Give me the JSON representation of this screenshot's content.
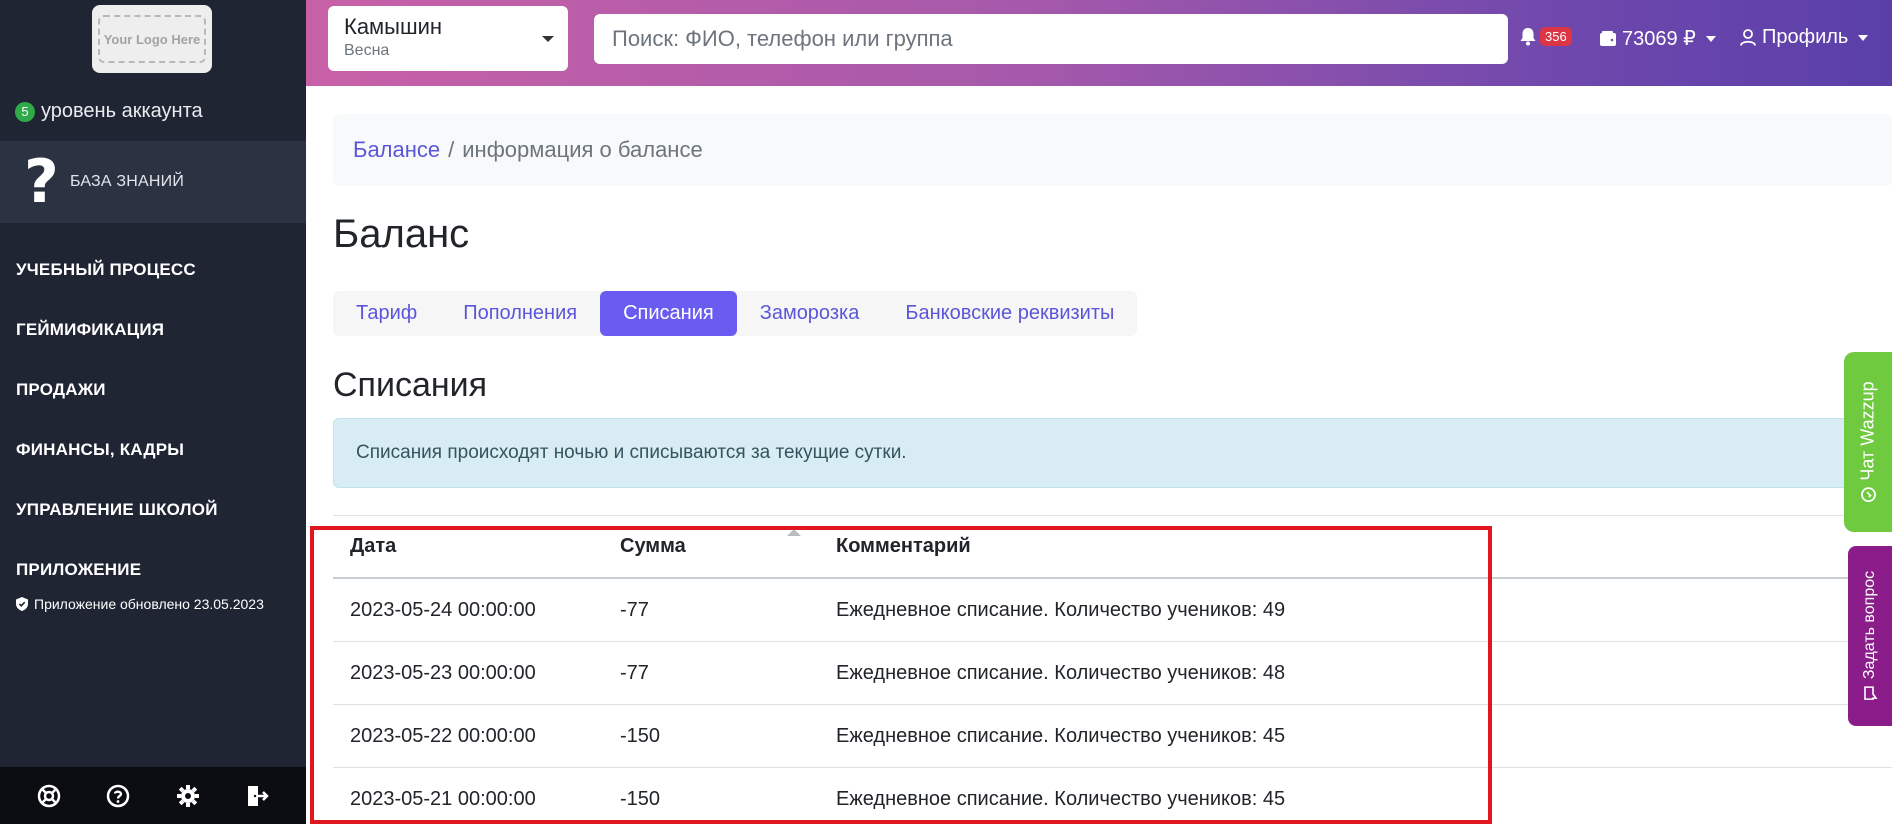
{
  "sidebar": {
    "logo_text": "Your Logo Here",
    "level_number": "5",
    "level_label": "уровень аккаунта",
    "knowledge_base_label": "БАЗА ЗНАНИЙ",
    "nav_items": [
      {
        "label": "УЧЕБНЫЙ ПРОЦЕСС"
      },
      {
        "label": "ГЕЙМИФИКАЦИЯ"
      },
      {
        "label": "ПРОДАЖИ"
      },
      {
        "label": "ФИНАНСЫ, КАДРЫ"
      },
      {
        "label": "УПРАВЛЕНИЕ ШКОЛОЙ"
      },
      {
        "label": "ПРИЛОЖЕНИЕ"
      }
    ],
    "update_note": "Приложение обновлено 23.05.2023",
    "bottom_icons": [
      "support-icon",
      "help-icon",
      "settings-icon",
      "logout-icon"
    ]
  },
  "header": {
    "city_name": "Камышин",
    "city_season": "Весна",
    "search_placeholder": "Поиск: ФИО, телефон или группа",
    "notifications_count": "356",
    "balance": "73069 ₽",
    "profile_label": "Профиль"
  },
  "breadcrumb": {
    "link": "Балансе",
    "separator": "/",
    "current": "информация о балансе"
  },
  "page_title": "Баланс",
  "tabs": [
    {
      "label": "Тариф",
      "active": false
    },
    {
      "label": "Пополнения",
      "active": false
    },
    {
      "label": "Списания",
      "active": true
    },
    {
      "label": "Заморозка",
      "active": false
    },
    {
      "label": "Банковские реквизиты",
      "active": false
    }
  ],
  "section_title": "Списания",
  "alert_text": "Списания происходят ночью и списываются за текущие сутки.",
  "table": {
    "headers": {
      "date": "Дата",
      "sum": "Сумма",
      "comment": "Комментарий"
    },
    "rows": [
      {
        "date": "2023-05-24 00:00:00",
        "sum": "-77",
        "comment": "Ежедневное списание. Количество учеников: 49"
      },
      {
        "date": "2023-05-23 00:00:00",
        "sum": "-77",
        "comment": "Ежедневное списание. Количество учеников: 48"
      },
      {
        "date": "2023-05-22 00:00:00",
        "sum": "-150",
        "comment": "Ежедневное списание. Количество учеников: 45"
      },
      {
        "date": "2023-05-21 00:00:00",
        "sum": "-150",
        "comment": "Ежедневное списание. Количество учеников: 45"
      }
    ]
  },
  "widgets": {
    "wazzup_label": "Чат Wazzup",
    "ask_label": "Задать вопрос"
  },
  "colors": {
    "sidebar_bg": "#1f2533",
    "accent": "#6a5cf0",
    "link": "#5b56d8",
    "badge_red": "#dc3545",
    "level_green": "#2eaa4a",
    "highlight_red": "#e0171e"
  }
}
